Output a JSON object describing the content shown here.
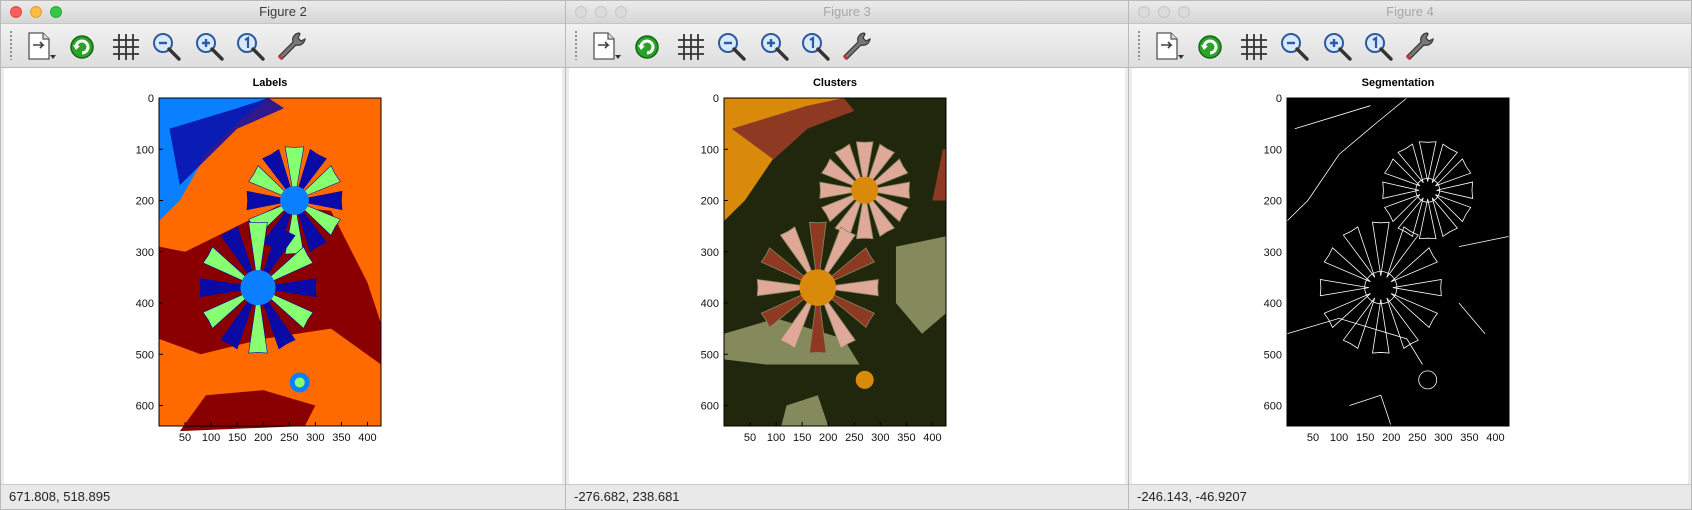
{
  "windows": [
    {
      "title": "Figure 2",
      "state": "active",
      "plot_title": "Labels",
      "status": "671.808,  518.895",
      "image_kind": "label-map",
      "palette": [
        "#0a0aa6",
        "#0a7fff",
        "#86ff70",
        "#ff6a00",
        "#8a0000"
      ]
    },
    {
      "title": "Figure 3",
      "state": "inactive",
      "plot_title": "Clusters",
      "status": "-276.682,  238.681",
      "image_kind": "cluster-map",
      "palette": [
        "#20270c",
        "#858a5c",
        "#8e3a22",
        "#e0a898",
        "#d98a0a"
      ]
    },
    {
      "title": "Figure 4",
      "state": "inactive",
      "plot_title": "Segmentation",
      "status": "-246.143, -46.9207",
      "image_kind": "edge-map",
      "palette": [
        "#000000",
        "#ffffff"
      ]
    }
  ],
  "toolbar": {
    "buttons": [
      {
        "name": "edit-plot-button",
        "icon": "edit-pointer-icon"
      },
      {
        "name": "refresh-button",
        "icon": "refresh-icon"
      },
      {
        "name": "grid-button",
        "icon": "grid-icon"
      },
      {
        "name": "zoom-out-button",
        "icon": "zoom-out-icon"
      },
      {
        "name": "zoom-in-button",
        "icon": "zoom-in-icon"
      },
      {
        "name": "zoom-reset-button",
        "icon": "zoom-reset-icon"
      },
      {
        "name": "settings-button",
        "icon": "wrench-icon"
      }
    ]
  },
  "axes": {
    "x_ticks": [
      "50",
      "100",
      "150",
      "200",
      "250",
      "300",
      "350",
      "400"
    ],
    "y_ticks": [
      "0",
      "100",
      "200",
      "300",
      "400",
      "500",
      "600"
    ]
  }
}
